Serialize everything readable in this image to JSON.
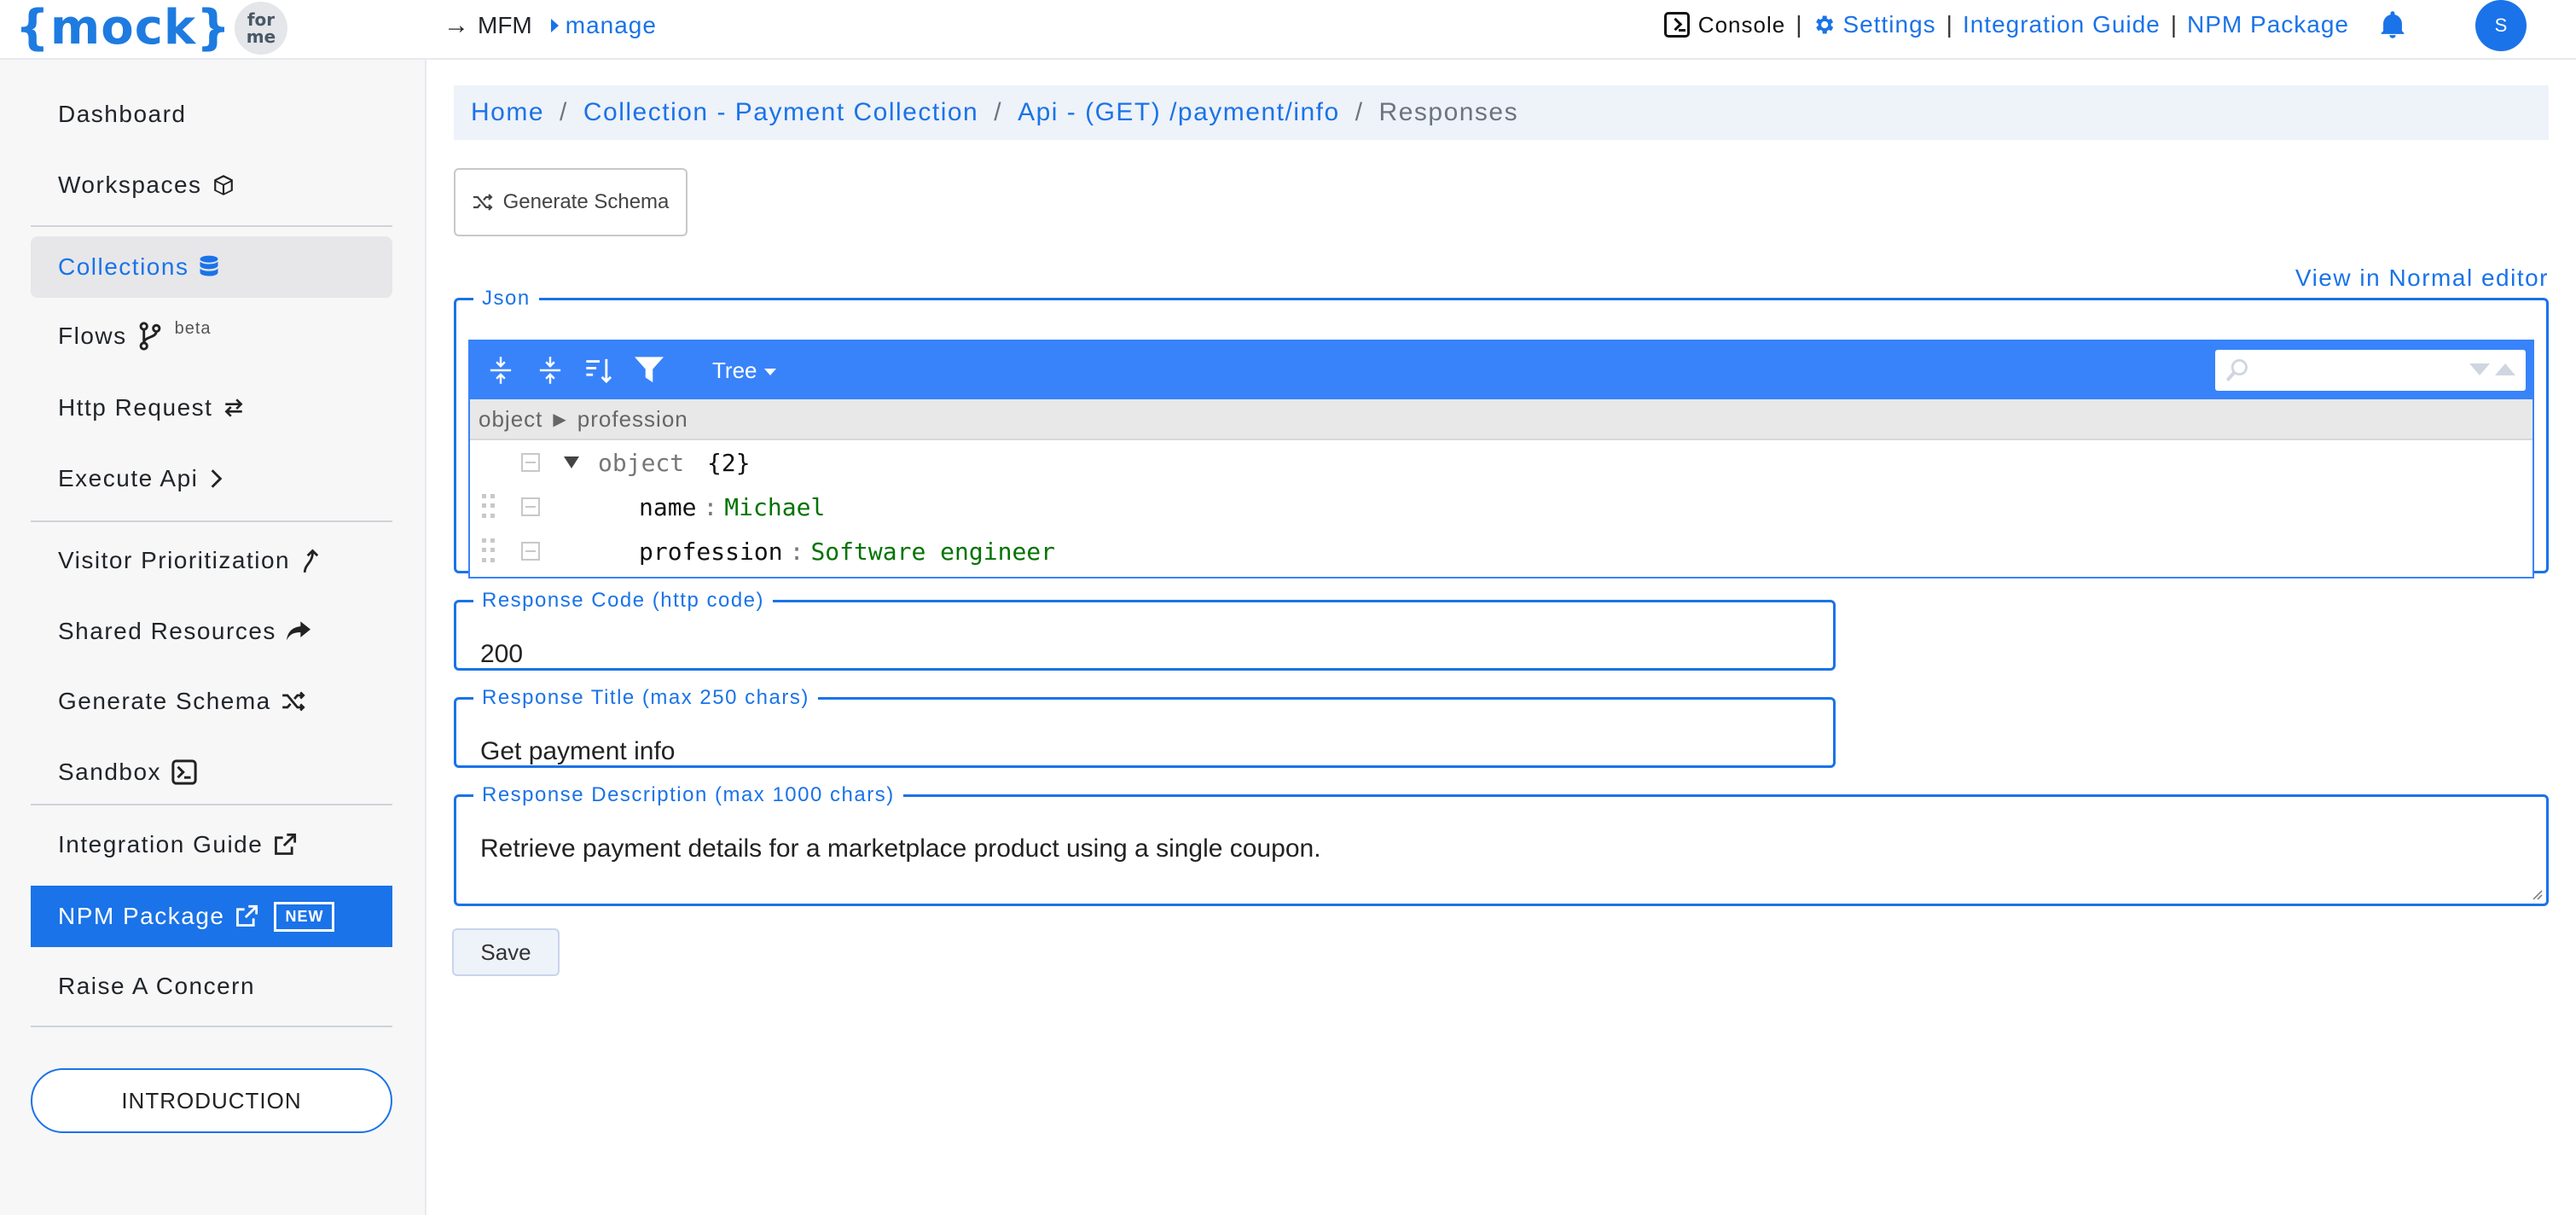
{
  "logo": {
    "text": "{mock}",
    "badge_top": "for",
    "badge_bottom": "me"
  },
  "nav": {
    "mfm": "MFM",
    "manage": "manage",
    "console": "Console",
    "settings": "Settings",
    "integration_guide": "Integration Guide",
    "npm_package": "NPM Package",
    "separator": "|",
    "avatar_initial": "S"
  },
  "sidebar": {
    "dashboard": "Dashboard",
    "workspaces": "Workspaces",
    "collections": "Collections",
    "flows": "Flows",
    "flows_badge": "beta",
    "http_request": "Http Request",
    "execute_api": "Execute Api",
    "visitor_prioritization": "Visitor Prioritization",
    "shared_resources": "Shared Resources",
    "generate_schema": "Generate Schema",
    "sandbox": "Sandbox",
    "integration_guide": "Integration Guide",
    "npm_package": "NPM Package",
    "npm_badge": "NEW",
    "raise_concern": "Raise A Concern",
    "introduction": "INTRODUCTION"
  },
  "breadcrumb": {
    "home": "Home",
    "collection": "Collection - Payment Collection",
    "api": "Api - (GET) /payment/info",
    "current": "Responses",
    "sep": "/"
  },
  "toolbar": {
    "generate_schema": "Generate Schema",
    "view_normal": "View in Normal editor"
  },
  "json_editor": {
    "legend": "Json",
    "mode": "Tree",
    "nav_path": [
      "object",
      "profession"
    ],
    "root_label": "object",
    "root_count": "{2}",
    "fields": [
      {
        "key": "name",
        "value": "Michael"
      },
      {
        "key": "profession",
        "value": "Software engineer"
      }
    ]
  },
  "form": {
    "code_label": "Response Code (http code)",
    "code_value": "200",
    "title_label": "Response Title (max 250 chars)",
    "title_value": "Get payment info",
    "desc_label": "Response Description (max 1000 chars)",
    "desc_value": "Retrieve payment details for a marketplace product using a single coupon.",
    "save": "Save"
  }
}
